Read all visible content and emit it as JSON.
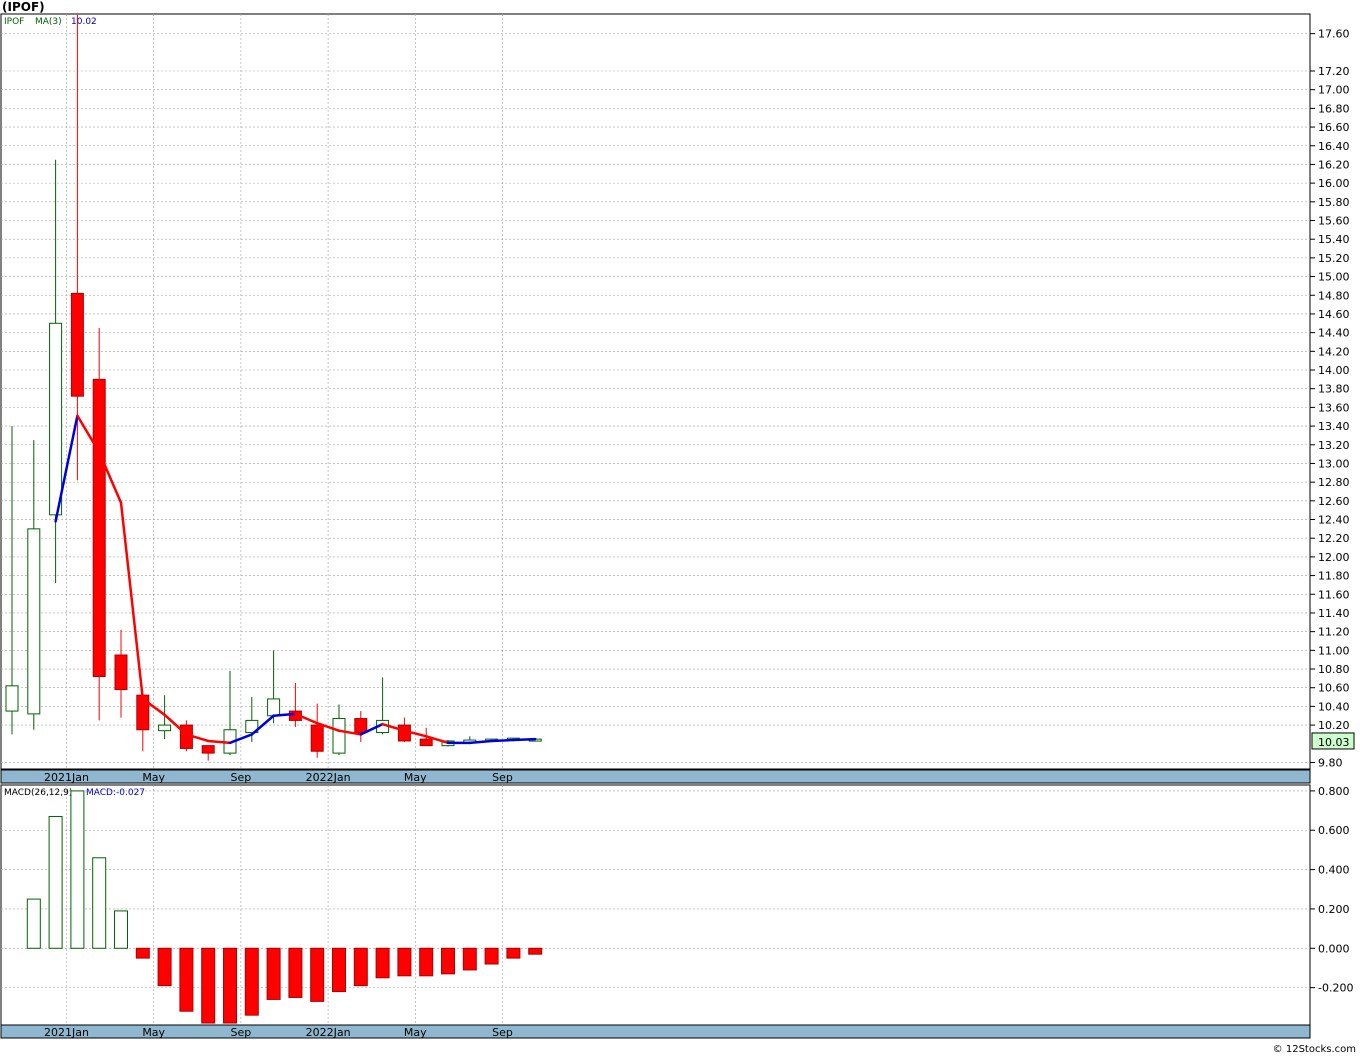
{
  "title": "(IPOF)",
  "footer": "© 12Stocks.com",
  "colors": {
    "up": "#006400",
    "down": "#ff0000",
    "ma_up": "#0000dd",
    "ma_down": "#ff0000",
    "axis_band": "#8fb8d0",
    "last_bg": "#ccffcc"
  },
  "chart_data": [
    {
      "type": "candlestick",
      "legend": {
        "symbol": "IPOF",
        "ma_label": "MA(3)",
        "ma_value": "10.02"
      },
      "last_price_label": "10.03",
      "ylim": [
        9.73,
        17.81
      ],
      "yticks": [
        "9.80",
        "10.20",
        "10.40",
        "10.60",
        "10.80",
        "11.00",
        "11.20",
        "11.40",
        "11.60",
        "11.80",
        "12.00",
        "12.20",
        "12.40",
        "12.60",
        "12.80",
        "13.00",
        "13.20",
        "13.40",
        "13.60",
        "13.80",
        "14.00",
        "14.20",
        "14.40",
        "14.60",
        "14.80",
        "15.00",
        "15.20",
        "15.40",
        "15.60",
        "15.80",
        "16.00",
        "16.20",
        "16.40",
        "16.60",
        "16.80",
        "17.00",
        "17.20",
        "17.60"
      ],
      "x_labels": [
        {
          "label": "2021Jan",
          "index": 2.5
        },
        {
          "label": "May",
          "index": 6.5
        },
        {
          "label": "Sep",
          "index": 10.5
        },
        {
          "label": "2022Jan",
          "index": 14.5
        },
        {
          "label": "May",
          "index": 18.5
        },
        {
          "label": "Sep",
          "index": 22.5
        }
      ],
      "candles": [
        {
          "o": 10.35,
          "h": 13.4,
          "l": 10.1,
          "c": 10.62
        },
        {
          "o": 10.32,
          "h": 13.25,
          "l": 10.15,
          "c": 12.3
        },
        {
          "o": 12.45,
          "h": 16.25,
          "l": 11.72,
          "c": 14.5
        },
        {
          "o": 14.82,
          "h": 17.8,
          "l": 12.82,
          "c": 13.72
        },
        {
          "o": 13.9,
          "h": 14.45,
          "l": 10.25,
          "c": 10.72
        },
        {
          "o": 10.95,
          "h": 11.22,
          "l": 10.28,
          "c": 10.58
        },
        {
          "o": 10.52,
          "h": 10.48,
          "l": 9.92,
          "c": 10.15
        },
        {
          "o": 10.14,
          "h": 10.52,
          "l": 10.05,
          "c": 10.2
        },
        {
          "o": 10.2,
          "h": 10.25,
          "l": 9.92,
          "c": 9.95
        },
        {
          "o": 9.98,
          "h": 9.98,
          "l": 9.82,
          "c": 9.9
        },
        {
          "o": 9.9,
          "h": 10.78,
          "l": 9.88,
          "c": 10.15
        },
        {
          "o": 10.12,
          "h": 10.5,
          "l": 10.02,
          "c": 10.25
        },
        {
          "o": 10.3,
          "h": 11.0,
          "l": 10.22,
          "c": 10.48
        },
        {
          "o": 10.35,
          "h": 10.65,
          "l": 10.18,
          "c": 10.25
        },
        {
          "o": 10.2,
          "h": 10.43,
          "l": 9.85,
          "c": 9.92
        },
        {
          "o": 9.9,
          "h": 10.42,
          "l": 9.88,
          "c": 10.27
        },
        {
          "o": 10.27,
          "h": 10.35,
          "l": 10.02,
          "c": 10.12
        },
        {
          "o": 10.12,
          "h": 10.71,
          "l": 10.1,
          "c": 10.25
        },
        {
          "o": 10.2,
          "h": 10.28,
          "l": 10.02,
          "c": 10.03
        },
        {
          "o": 10.05,
          "h": 10.17,
          "l": 9.98,
          "c": 9.98
        },
        {
          "o": 9.98,
          "h": 10.04,
          "l": 9.97,
          "c": 10.03
        },
        {
          "o": 10.01,
          "h": 10.08,
          "l": 10.0,
          "c": 10.04
        },
        {
          "o": 10.03,
          "h": 10.05,
          "l": 10.02,
          "c": 10.05
        },
        {
          "o": 10.04,
          "h": 10.06,
          "l": 10.03,
          "c": 10.06
        },
        {
          "o": 10.05,
          "h": 10.06,
          "l": 10.04,
          "c": 10.05
        }
      ],
      "ma3": [
        null,
        null,
        12.38,
        13.51,
        13.12,
        12.58,
        10.48,
        10.31,
        10.1,
        10.03,
        10.01,
        10.1,
        10.3,
        10.32,
        10.22,
        10.14,
        10.1,
        10.21,
        10.14,
        10.08,
        10.01,
        10.01,
        10.03,
        10.04,
        10.05
      ]
    },
    {
      "type": "bar",
      "legend": {
        "name": "MACD(26,12,9)",
        "value_label": "MACD:-0.027"
      },
      "ylim": [
        -0.39,
        0.83
      ],
      "yticks": [
        "0.800",
        "0.600",
        "0.400",
        "0.200",
        "0.000",
        "-0.200"
      ],
      "x_labels": [
        {
          "label": "2021Jan",
          "index": 2.5
        },
        {
          "label": "May",
          "index": 6.5
        },
        {
          "label": "Sep",
          "index": 10.5
        },
        {
          "label": "2022Jan",
          "index": 14.5
        },
        {
          "label": "May",
          "index": 18.5
        },
        {
          "label": "Sep",
          "index": 22.5
        }
      ],
      "values": [
        null,
        0.25,
        0.67,
        0.8,
        0.46,
        0.19,
        -0.05,
        -0.19,
        -0.32,
        -0.38,
        -0.38,
        -0.34,
        -0.26,
        -0.25,
        -0.27,
        -0.22,
        -0.19,
        -0.15,
        -0.14,
        -0.14,
        -0.13,
        -0.11,
        -0.08,
        -0.05,
        -0.03
      ]
    }
  ]
}
